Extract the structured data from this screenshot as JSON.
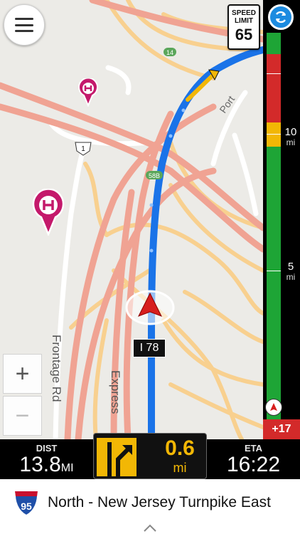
{
  "map": {
    "route_label": "I 78",
    "road_labels": {
      "frontage": "Frontage Rd",
      "express": "Express",
      "port": "Port",
      "exit_58b": "58B",
      "route_14": "14",
      "us_1": "1"
    },
    "zoom_in_label": "+",
    "zoom_out_label": "−"
  },
  "speed_limit": {
    "line1": "SPEED",
    "line2": "LIMIT",
    "value": "65"
  },
  "progress": {
    "marker_10": {
      "value": "10",
      "unit": "mi"
    },
    "marker_5": {
      "value": "5",
      "unit": "mi"
    },
    "delta": "+17"
  },
  "stats": {
    "dist": {
      "label": "DIST",
      "value": "13.8",
      "unit": "MI"
    },
    "eta": {
      "label": "ETA",
      "value": "16:22"
    }
  },
  "next_turn": {
    "value": "0.6",
    "unit": "mi"
  },
  "street": {
    "shield": "95",
    "name": "North - New Jersey Turnpike East"
  },
  "colors": {
    "route": "#1a73e8",
    "major_road": "#f0a393",
    "minor_road": "#f8d08f",
    "accent_yellow": "#f2b705",
    "traffic_green": "#1ea536",
    "traffic_red": "#d32a2a",
    "poi_pink": "#c4196b"
  }
}
